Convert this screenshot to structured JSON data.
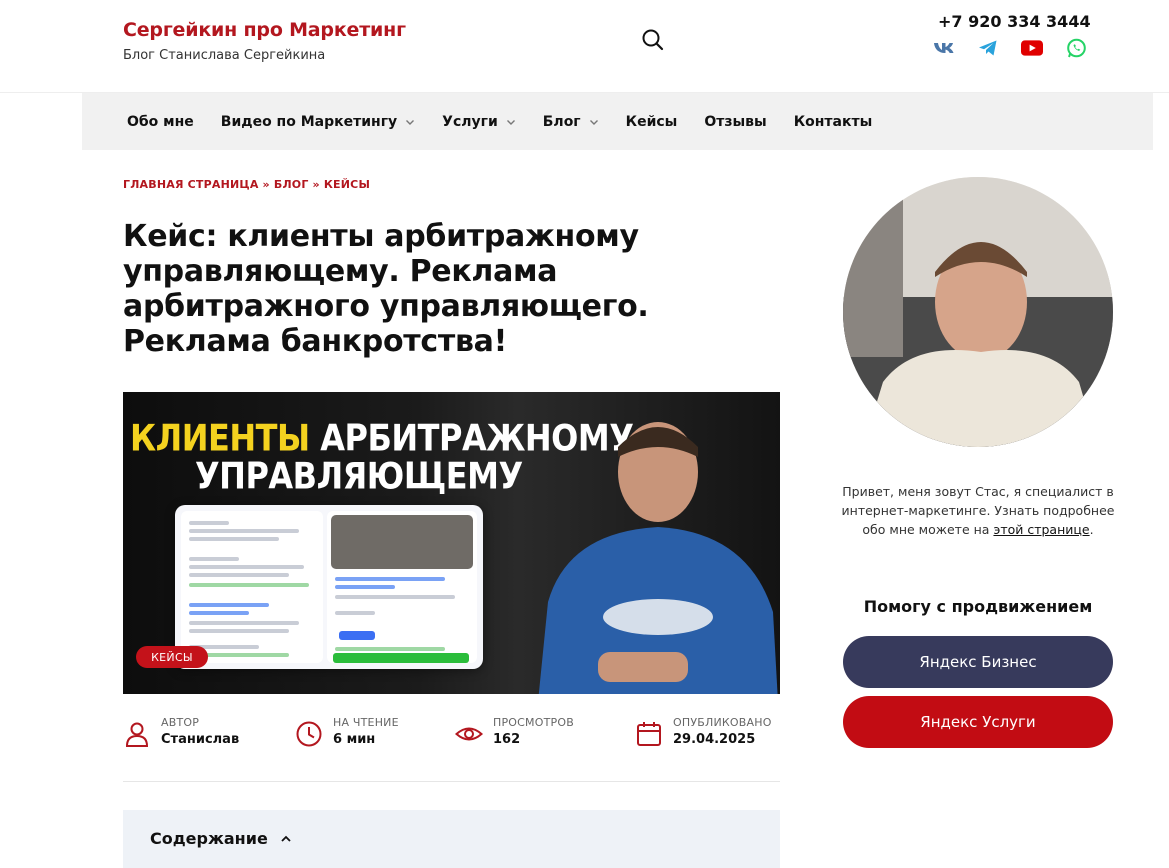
{
  "header": {
    "site_title": "Сергейкин про Маркетинг",
    "site_description": "Блог Станислава Сергейкина",
    "phone": "+7 920 334 3444",
    "socials": [
      {
        "icon": "vk-icon",
        "color": "#4a76a8"
      },
      {
        "icon": "telegram-icon",
        "color": "#2aa3dc"
      },
      {
        "icon": "youtube-icon",
        "color": "#e00000"
      },
      {
        "icon": "whatsapp-icon",
        "color": "#25d366"
      }
    ]
  },
  "nav": {
    "items": [
      {
        "label": "Обо мне",
        "dropdown": false
      },
      {
        "label": "Видео по Маркетингу",
        "dropdown": true
      },
      {
        "label": "Услуги",
        "dropdown": true
      },
      {
        "label": "Блог",
        "dropdown": true
      },
      {
        "label": "Кейсы",
        "dropdown": false
      },
      {
        "label": "Отзывы",
        "dropdown": false
      },
      {
        "label": "Контакты",
        "dropdown": false
      }
    ]
  },
  "breadcrumb": {
    "home": "ГЛАВНАЯ СТРАНИЦА",
    "sep": "»",
    "blog": "БЛОГ",
    "current": "КЕЙСЫ"
  },
  "article": {
    "title": "Кейс: клиенты арбитражному управляющему. Реклама арбитражного управляющего. Реклама банкротства!",
    "hero": {
      "line1_yellow": "КЛИЕНТЫ",
      "line1_white": "АРБИТРАЖНОМУ",
      "line2": "УПРАВЛЯЮЩЕМУ",
      "badge": "КЕЙСЫ"
    },
    "meta": [
      {
        "icon": "user-icon",
        "label": "АВТОР",
        "value": "Станислав"
      },
      {
        "icon": "clock-icon",
        "label": "НА ЧТЕНИЕ",
        "value": "6 мин"
      },
      {
        "icon": "eye-icon",
        "label": "ПРОСМОТРОВ",
        "value": "162"
      },
      {
        "icon": "calendar-icon",
        "label": "ОПУБЛИКОВАНО",
        "value": "29.04.2025"
      }
    ],
    "toc_title": "Содержание"
  },
  "sidebar": {
    "about_text": "Привет, меня зовут Стас, я специалист в интернет-маркетинге. Узнать подробнее обо мне можете на",
    "about_link": "этой странице",
    "about_end": ".",
    "help_title": "Помогу с продвижением",
    "buttons": [
      {
        "label": "Яндекс Бизнес",
        "color": "#373a5c"
      },
      {
        "label": "Яндекс Услуги",
        "color": "#c20c13"
      }
    ]
  },
  "colors": {
    "accent": "#b3171f",
    "nav_bg": "#f1f1f1"
  }
}
